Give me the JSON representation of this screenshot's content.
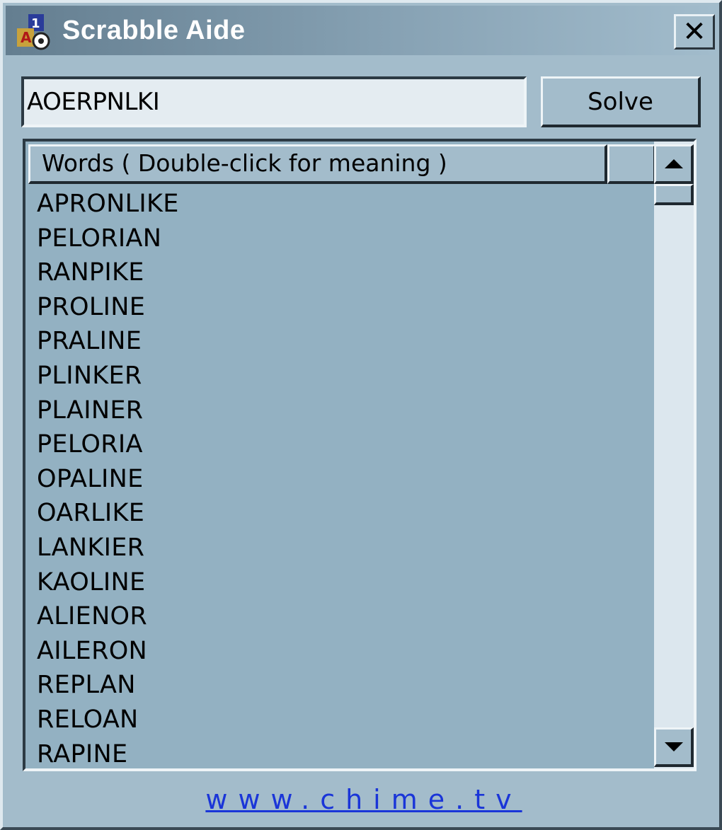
{
  "window": {
    "title": "Scrabble Aide",
    "close_label": "✕",
    "icons": {
      "app": "scrabble-app-icon",
      "close": "close-icon"
    }
  },
  "input": {
    "value": "AOERPNLKI"
  },
  "solve_label": "Solve",
  "list": {
    "header": "Words ( Double-click for meaning )",
    "words": [
      "APRONLIKE",
      "PELORIAN",
      "RANPIKE",
      "PROLINE",
      "PRALINE",
      "PLINKER",
      "PLAINER",
      "PELORIA",
      "OPALINE",
      "OARLIKE",
      "LANKIER",
      "KAOLINE",
      "ALIENOR",
      "AILERON",
      "REPLAN",
      "RELOAN",
      "RAPINE"
    ],
    "scroll_icons": {
      "up": "scroll-up-arrow-icon",
      "down": "scroll-down-arrow-icon"
    }
  },
  "footer": {
    "link": "www.chime.tv"
  },
  "colors": {
    "window_bg": "#a3bccb",
    "list_bg": "#93b1c2",
    "link": "#1a35d8"
  }
}
